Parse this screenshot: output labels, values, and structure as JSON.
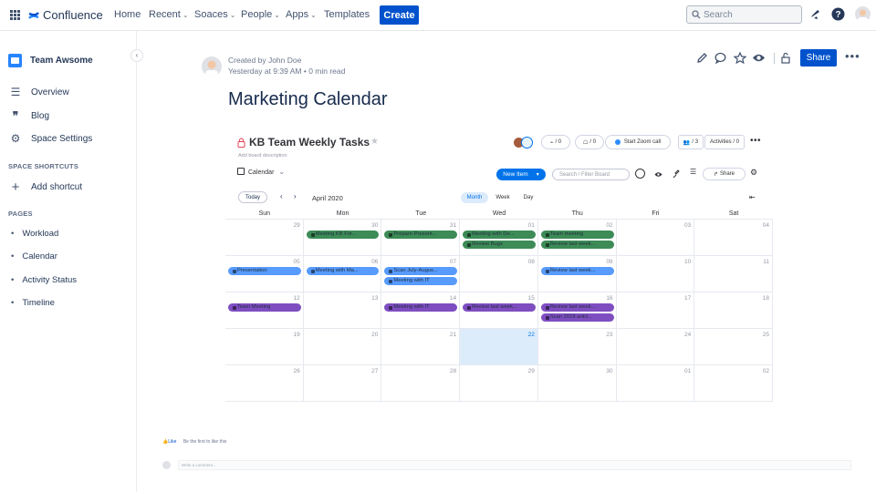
{
  "topnav": {
    "product": "Confluence",
    "items": [
      {
        "label": "Home",
        "dropdown": false
      },
      {
        "label": "Recent",
        "dropdown": true
      },
      {
        "label": "Soaces",
        "dropdown": true
      },
      {
        "label": "People",
        "dropdown": true
      },
      {
        "label": "Apps",
        "dropdown": true
      },
      {
        "label": "Templates",
        "dropdown": false
      }
    ],
    "create_label": "Create",
    "search_placeholder": "Search"
  },
  "sidebar": {
    "space_name": "Team Awsome",
    "items": [
      {
        "label": "Overview",
        "icon": "menu-lines-icon"
      },
      {
        "label": "Blog",
        "icon": "quote-icon"
      },
      {
        "label": "Space Settings",
        "icon": "gear-icon"
      }
    ],
    "shortcuts_heading": "SPACE SHORTCUTS",
    "add_shortcut": "Add shortcut",
    "pages_heading": "PAGES",
    "pages": [
      "Workload",
      "Calendar",
      "Activity Status",
      "Timeline"
    ]
  },
  "page": {
    "created_by": "Created by John Doe",
    "meta": "Yesterday at 9:39 AM  •  0 min read",
    "title": "Marketing Calendar",
    "share_label": "Share"
  },
  "board": {
    "title": "KB Team Weekly Tasks",
    "description": "Add board description",
    "invites": "/ 0",
    "updates": "/ 0",
    "zoom": "Start Zoom call",
    "members": "/ 3",
    "activities": "Activities / 0",
    "view": "Calendar",
    "new_item": "New Item",
    "filter_placeholder": "Search / Filter Board",
    "share_label": "Share",
    "today": "Today",
    "month": "April 2020",
    "view_tabs": [
      "Month",
      "Week",
      "Day"
    ],
    "days": [
      "Sun",
      "Mon",
      "Tue",
      "Wed",
      "Thu",
      "Fri",
      "Sat"
    ],
    "weeks": [
      [
        "29",
        "30",
        "31",
        "01",
        "02",
        "03",
        "04"
      ],
      [
        "05",
        "06",
        "07",
        "08",
        "09",
        "10",
        "11"
      ],
      [
        "12",
        "13",
        "14",
        "15",
        "16",
        "17",
        "18"
      ],
      [
        "19",
        "20",
        "21",
        "22",
        "23",
        "24",
        "25"
      ],
      [
        "26",
        "27",
        "28",
        "29",
        "30",
        "01",
        "02"
      ]
    ],
    "today_date": "22",
    "colors": {
      "green": "#3d8b57",
      "blue": "#579bfc",
      "purple": "#7e4ec1"
    },
    "events": [
      {
        "week": 0,
        "day": 1,
        "slot": 0,
        "label": "Meeting KB For...",
        "color": "green"
      },
      {
        "week": 0,
        "day": 2,
        "slot": 0,
        "label": "Prepare Present...",
        "color": "green"
      },
      {
        "week": 0,
        "day": 3,
        "slot": 0,
        "label": "Meeting with De...",
        "color": "green"
      },
      {
        "week": 0,
        "day": 3,
        "slot": 1,
        "label": "Review Bugs",
        "color": "green"
      },
      {
        "week": 0,
        "day": 4,
        "slot": 0,
        "label": "Team meeting",
        "color": "green"
      },
      {
        "week": 0,
        "day": 4,
        "slot": 1,
        "label": "Review last week...",
        "color": "green"
      },
      {
        "week": 1,
        "day": 0,
        "slot": 0,
        "label": "Presentation",
        "color": "blue"
      },
      {
        "week": 1,
        "day": 1,
        "slot": 0,
        "label": "Meeting with Ma...",
        "color": "blue"
      },
      {
        "week": 1,
        "day": 2,
        "slot": 0,
        "label": "Scan July-Augus...",
        "color": "blue"
      },
      {
        "week": 1,
        "day": 2,
        "slot": 1,
        "label": "Meeting with IT",
        "color": "blue"
      },
      {
        "week": 1,
        "day": 4,
        "slot": 0,
        "label": "Review last week...",
        "color": "blue"
      },
      {
        "week": 2,
        "day": 0,
        "slot": 0,
        "label": "Team Meeting",
        "color": "purple"
      },
      {
        "week": 2,
        "day": 2,
        "slot": 0,
        "label": "Meeting with IT",
        "color": "purple"
      },
      {
        "week": 2,
        "day": 3,
        "slot": 0,
        "label": "Review last week...",
        "color": "purple"
      },
      {
        "week": 2,
        "day": 4,
        "slot": 0,
        "label": "Review last week...",
        "color": "purple"
      },
      {
        "week": 2,
        "day": 4,
        "slot": 1,
        "label": "Scan 2018 articl...",
        "color": "purple"
      }
    ]
  },
  "footer": {
    "like": "Like",
    "like_hint": "Be the first to like this",
    "comment_placeholder": "Write a comment..."
  }
}
